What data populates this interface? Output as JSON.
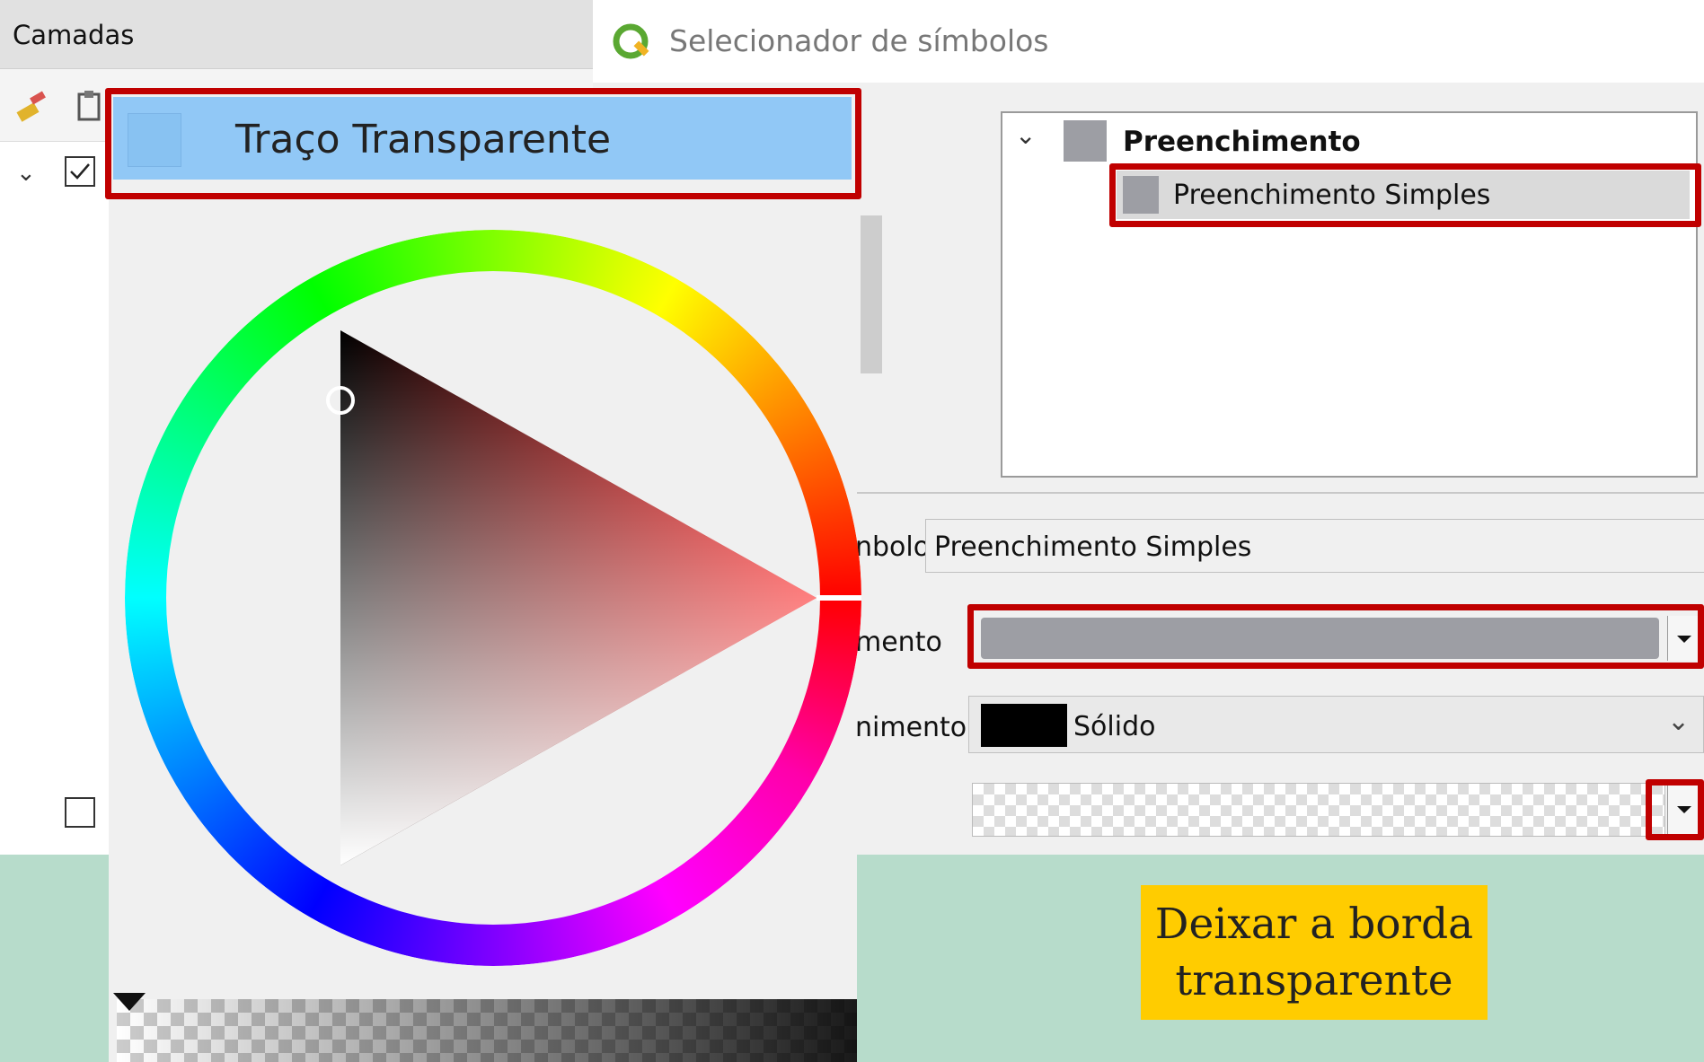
{
  "layers_panel": {
    "title": "Camadas"
  },
  "dialog": {
    "title": "Selecionador de símbolos",
    "tree": {
      "root_label": "Preenchimento",
      "child_label": "Preenchimento Simples"
    },
    "symbol_layer_type": {
      "label_partial": "nbolo",
      "value": "Preenchimento Simples"
    },
    "fill_color": {
      "label_partial": "mento",
      "value_color": "#9d9ea4"
    },
    "fill_style": {
      "label_partial": "nimento",
      "value": "Sólido",
      "swatch_color": "#000000"
    }
  },
  "color_popup": {
    "item_label": "Traço Transparente",
    "item_color": "#91c8f6"
  },
  "caption": {
    "line1": "Deixar a borda",
    "line2": "transparente"
  },
  "colors": {
    "highlight_red": "#c00000",
    "caption_bg": "#ffcc00",
    "background": "#b7dccb"
  }
}
